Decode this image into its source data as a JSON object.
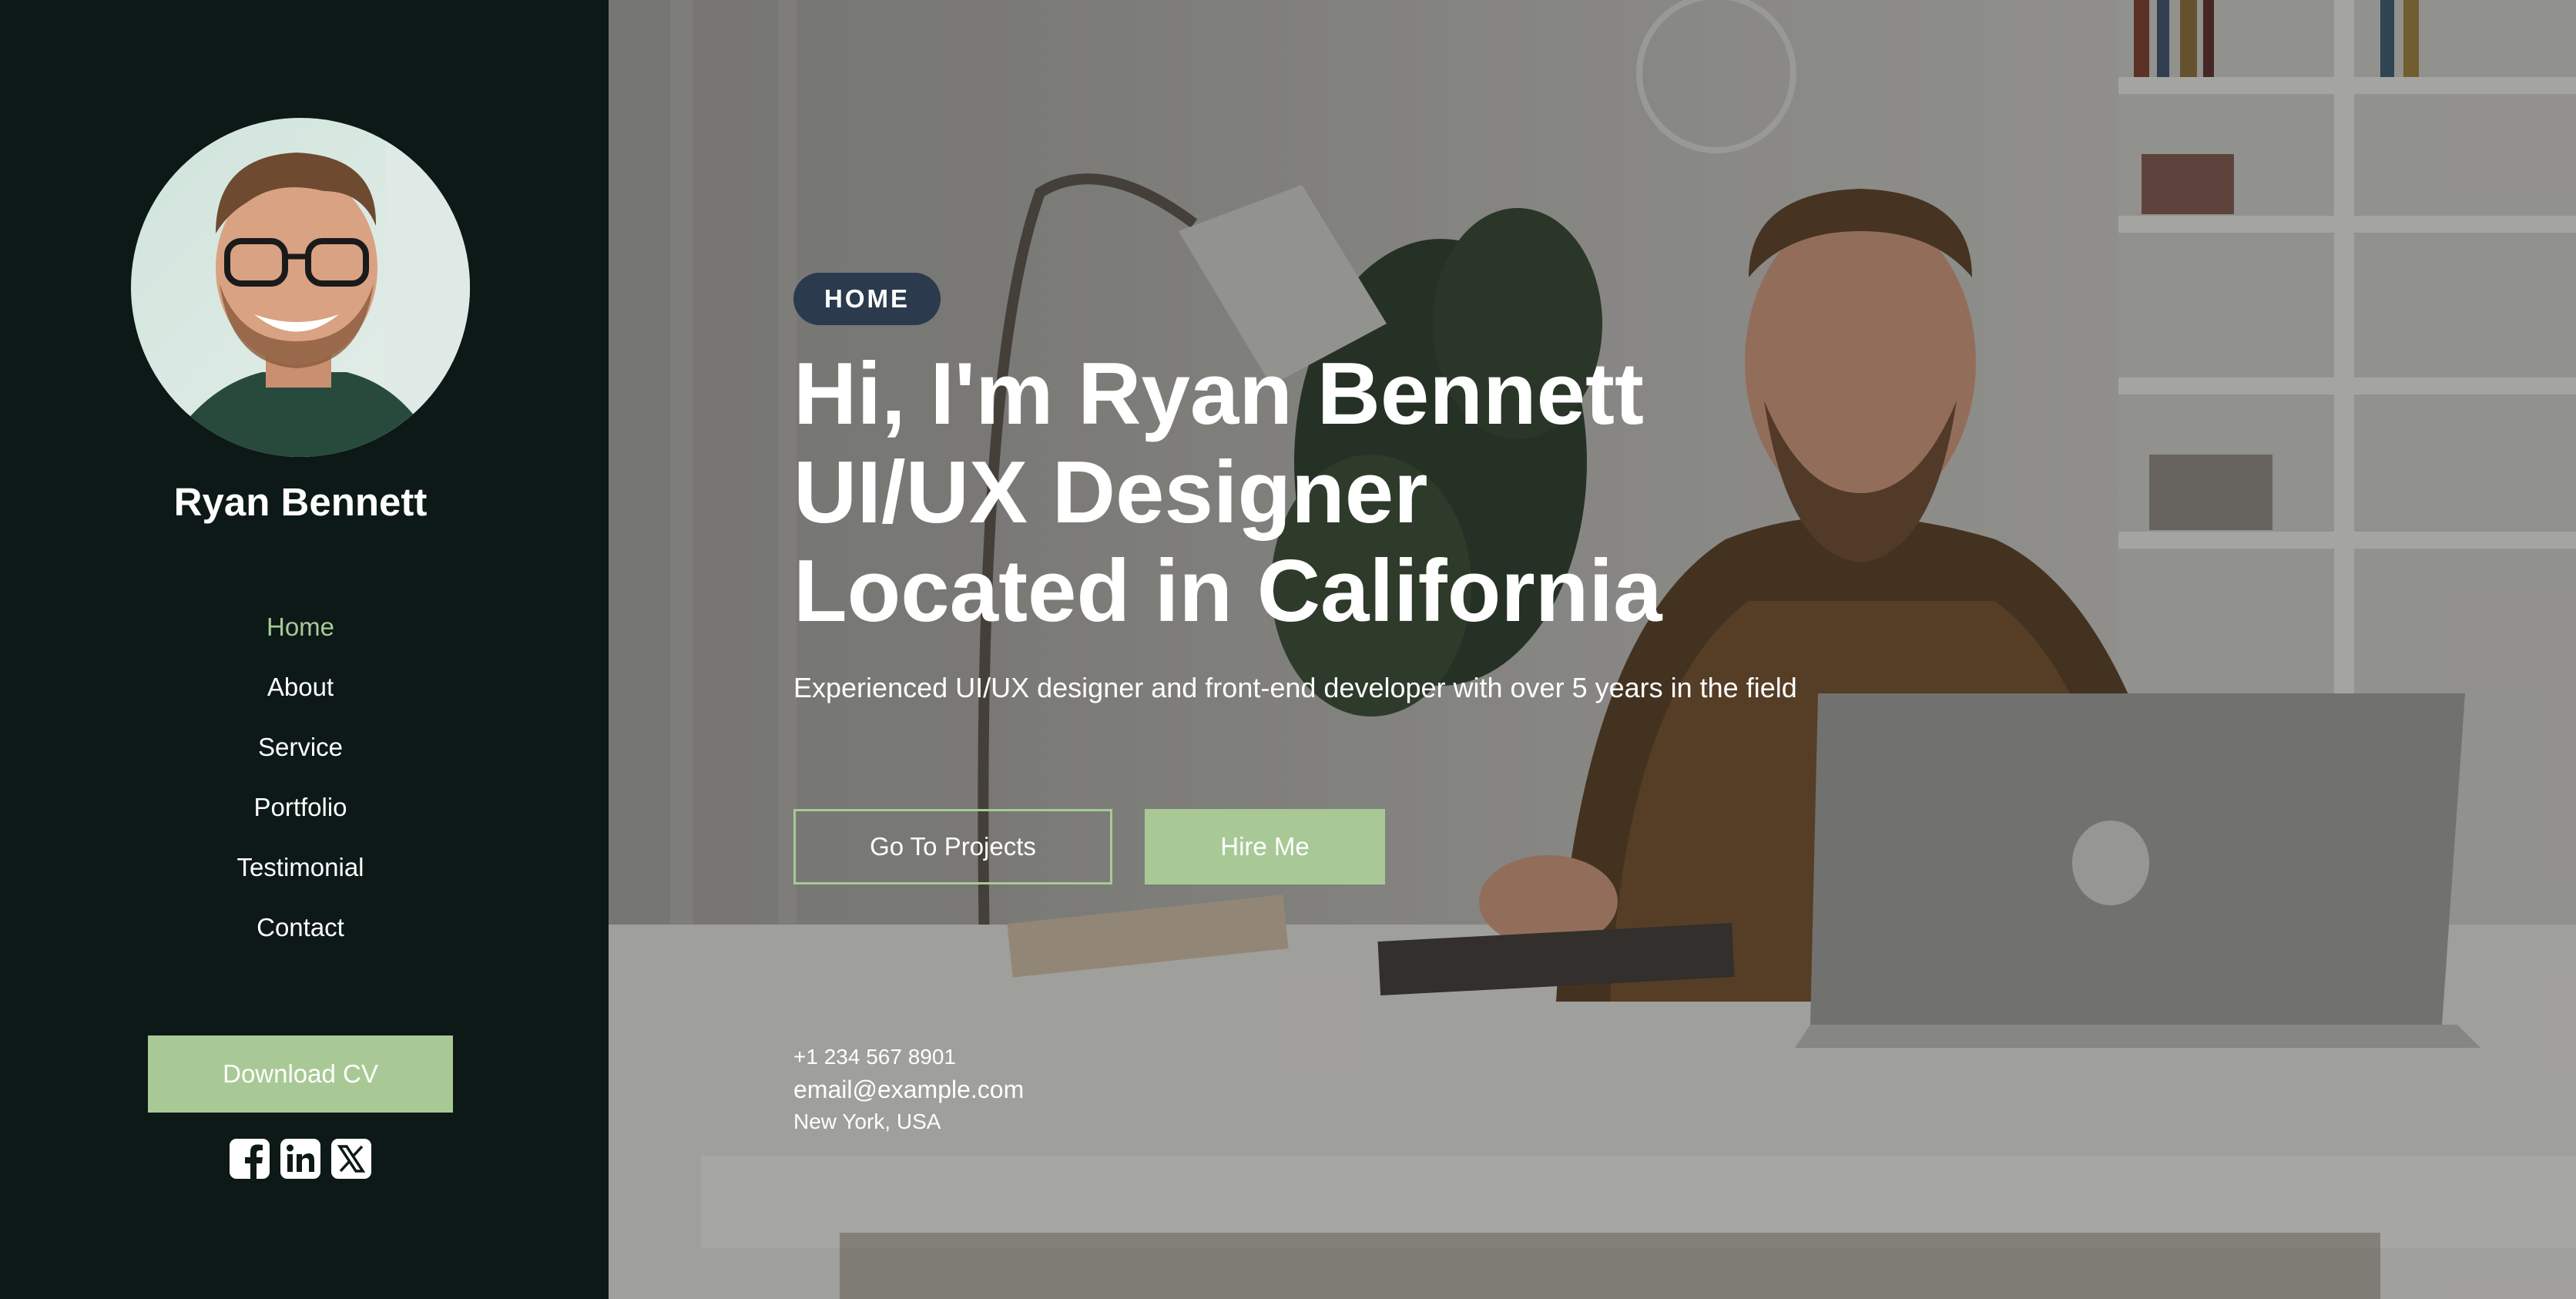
{
  "sidebar": {
    "name": "Ryan Bennett",
    "nav": [
      {
        "label": "Home",
        "active": true
      },
      {
        "label": "About",
        "active": false
      },
      {
        "label": "Service",
        "active": false
      },
      {
        "label": "Portfolio",
        "active": false
      },
      {
        "label": "Testimonial",
        "active": false
      },
      {
        "label": "Contact",
        "active": false
      }
    ],
    "download_label": "Download CV",
    "socials": [
      "facebook-icon",
      "linkedin-icon",
      "x-icon"
    ]
  },
  "hero": {
    "badge": "HOME",
    "headline": [
      "Hi, I'm Ryan Bennett",
      "UI/UX Designer",
      "Located in California"
    ],
    "subtitle": "Experienced UI/UX designer and front-end developer with over 5 years in the field",
    "primary_button": "Go To Projects",
    "secondary_button": "Hire Me",
    "contact": {
      "phone": "+1 234 567 8901",
      "email": "email@example.com",
      "location": "New York, USA"
    }
  },
  "colors": {
    "sidebar_bg": "#0c1917",
    "accent": "#a8c995",
    "badge_bg": "#2b3a4d",
    "text": "#ffffff"
  }
}
